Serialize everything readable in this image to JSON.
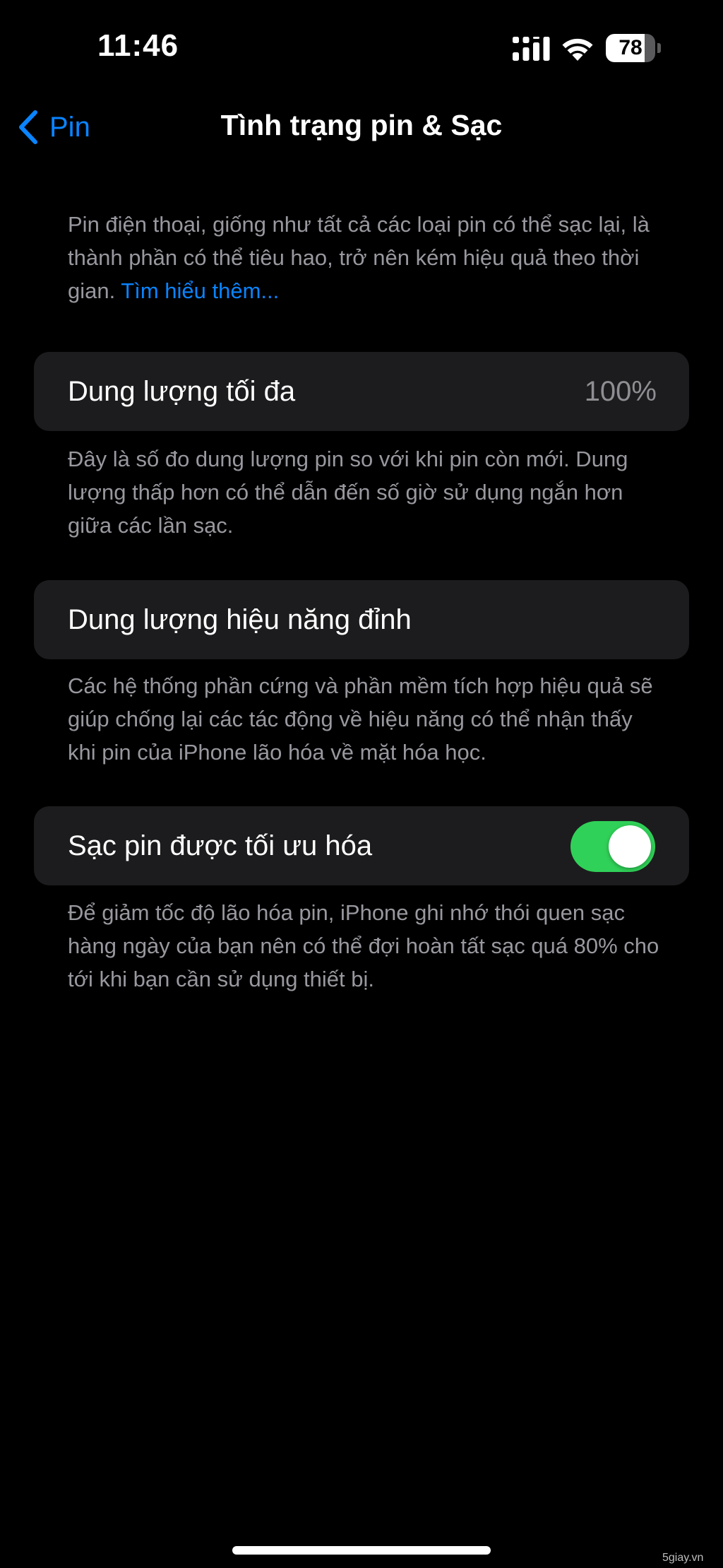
{
  "status_bar": {
    "time": "11:46",
    "signal_icon": "cellular-signal-icon",
    "wifi_icon": "wifi-icon",
    "battery_level": "78",
    "battery_fraction": 0.78
  },
  "nav": {
    "back_label": "Pin",
    "back_icon": "chevron-left-icon",
    "title": "Tình trạng pin & Sạc"
  },
  "intro": {
    "text": "Pin điện thoại, giống như tất cả các loại pin có thể sạc lại, là thành phần có thể tiêu hao, trở nên kém hiệu quả theo thời gian.",
    "link": "Tìm hiểu thêm..."
  },
  "max_capacity": {
    "label": "Dung lượng tối đa",
    "value": "100%",
    "description": "Đây là số đo dung lượng pin so với khi pin còn mới. Dung lượng thấp hơn có thể dẫn đến số giờ sử dụng ngắn hơn giữa các lần sạc."
  },
  "peak_performance": {
    "label": "Dung lượng hiệu năng đỉnh",
    "description": "Các hệ thống phần cứng và phần mềm tích hợp hiệu quả sẽ giúp chống lại các tác động về hiệu năng có thể nhận thấy khi pin của iPhone lão hóa về mặt hóa học."
  },
  "optimized_charging": {
    "label": "Sạc pin được tối ưu hóa",
    "enabled": true,
    "description": "Để giảm tốc độ lão hóa pin, iPhone ghi nhớ thói quen sạc hàng ngày của bạn nên có thể đợi hoàn tất sạc quá 80% cho tới khi bạn cần sử dụng thiết bị."
  },
  "colors": {
    "accent": "#0a84ff",
    "toggle_on": "#30d158",
    "card_bg": "#1c1c1e",
    "secondary_text": "#98989f"
  },
  "watermark": "5giay.vn"
}
